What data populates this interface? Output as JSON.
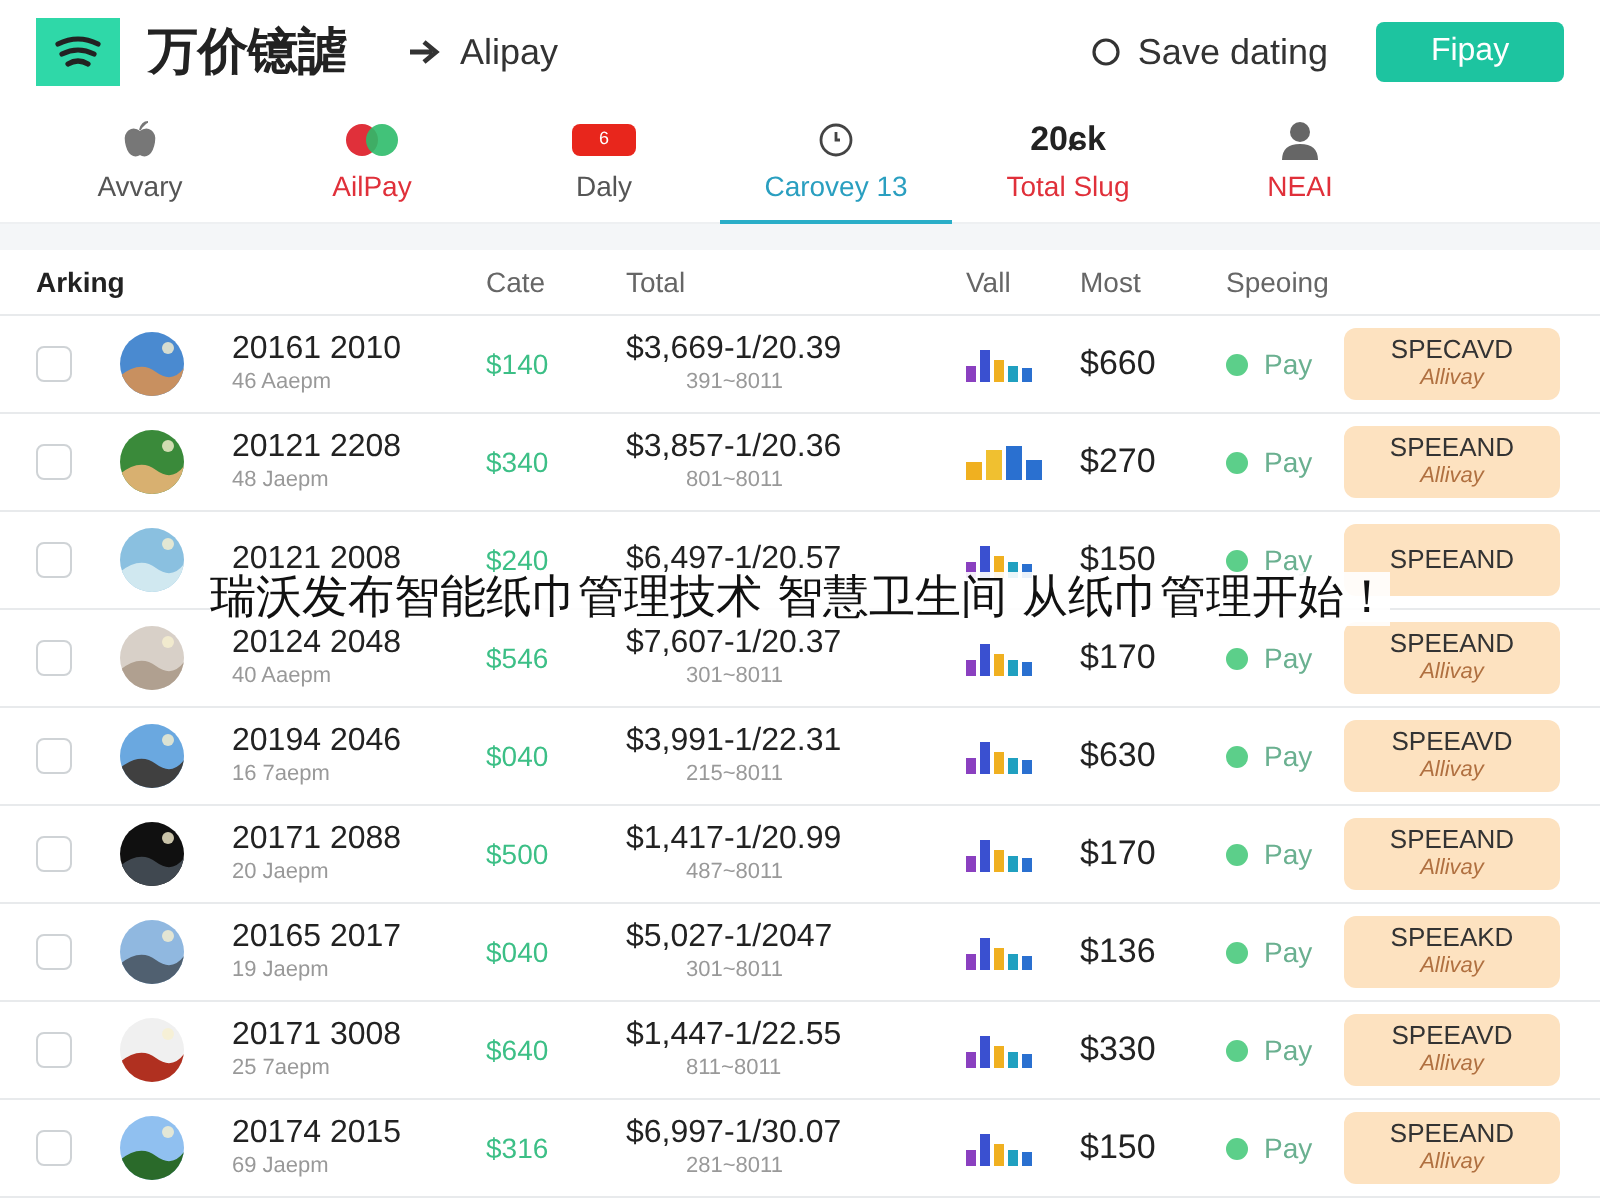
{
  "header": {
    "title": "万价镱謔",
    "breadcrumb": "Alipay",
    "search_label": "Save dating",
    "action_button": "Fipay"
  },
  "tabs": [
    {
      "kind": "apple",
      "label": "Avvary",
      "color": "#555555",
      "selected": false
    },
    {
      "kind": "rings",
      "label": "AilPay",
      "color": "#e0303a",
      "selected": false
    },
    {
      "kind": "badge",
      "badge": "6",
      "label": "Daly",
      "color": "#555555",
      "selected": false
    },
    {
      "kind": "clock",
      "label": "Carovey 13",
      "color": "#2a9fc0",
      "selected": true
    },
    {
      "kind": "value",
      "value": "20ɕk",
      "label": "Total Slug",
      "color": "#e0303a",
      "selected": false
    },
    {
      "kind": "person",
      "label": "NEAI",
      "color": "#e0303a",
      "selected": false
    }
  ],
  "table": {
    "columns": [
      "Arking",
      "Cate",
      "Total",
      "Vall",
      "Most",
      "Speoing"
    ],
    "rows": [
      {
        "checked": false,
        "name": "20161 2010",
        "time": "46 Aaepm",
        "cate": "$140",
        "total": "$3,669-1/20.39",
        "total_sub": "391~8011",
        "most": "$660",
        "status": "Pay",
        "tag": "SPECAVD",
        "tag_sub": "Allivay"
      },
      {
        "checked": false,
        "name": "20121 2208",
        "time": "48 Jaepm",
        "cate": "$340",
        "total": "$3,857-1/20.36",
        "total_sub": "801~8011",
        "most": "$270",
        "status": "Pay",
        "tag": "SPEEAND",
        "tag_sub": "Allivay"
      },
      {
        "checked": false,
        "name": "20121 2008",
        "cate": "$240",
        "total": "$6,497-1/20.57",
        "most": "$150",
        "status": "Pay",
        "tag": "SPEEAND"
      },
      {
        "checked": false,
        "name": "20124 2048",
        "time": "40 Aaepm",
        "cate": "$546",
        "total": "$7,607-1/20.37",
        "total_sub": "301~8011",
        "most": "$170",
        "status": "Pay",
        "tag": "SPEEAND",
        "tag_sub": "Allivay"
      },
      {
        "checked": false,
        "name": "20194 2046",
        "time": "16 7aepm",
        "cate": "$040",
        "total": "$3,991-1/22.31",
        "total_sub": "215~8011",
        "most": "$630",
        "status": "Pay",
        "tag": "SPEEAVD",
        "tag_sub": "Allivay"
      },
      {
        "checked": false,
        "name": "20171 2088",
        "time": "20 Jaepm",
        "cate": "$500",
        "total": "$1,417-1/20.99",
        "total_sub": "487~8011",
        "most": "$170",
        "status": "Pay",
        "tag": "SPEEAND",
        "tag_sub": "Allivay"
      },
      {
        "checked": false,
        "name": "20165 2017",
        "time": "19 Jaepm",
        "cate": "$040",
        "total": "$5,027-1/2047",
        "total_sub": "301~8011",
        "most": "$136",
        "status": "Pay",
        "tag": "SPEEAKD",
        "tag_sub": "Allivay"
      },
      {
        "checked": false,
        "name": "20171 3008",
        "time": "25 7aepm",
        "cate": "$640",
        "total": "$1,447-1/22.55",
        "total_sub": "811~8011",
        "most": "$330",
        "status": "Pay",
        "tag": "SPEEAVD",
        "tag_sub": "Allivay"
      },
      {
        "checked": false,
        "name": "20174 2015",
        "time": "69 Jaepm",
        "cate": "$316",
        "total": "$6,997-1/30.07",
        "total_sub": "281~8011",
        "most": "$150",
        "status": "Pay",
        "tag": "SPEEAND",
        "tag_sub": "Allivay"
      }
    ]
  },
  "headline": "瑞沃发布智能纸巾管理技术 智慧卫生间 从纸巾管理开始！"
}
